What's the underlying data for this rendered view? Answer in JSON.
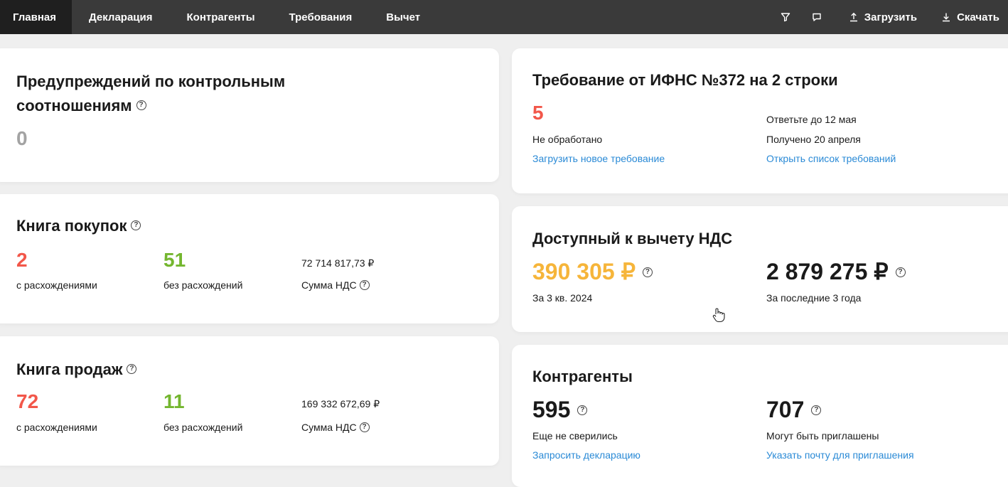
{
  "nav": {
    "tabs": [
      "Главная",
      "Декларация",
      "Контрагенты",
      "Требования",
      "Вычет"
    ],
    "upload": "Загрузить",
    "download": "Скачать",
    "icons": [
      "filter-icon",
      "comment-icon",
      "upload-icon",
      "download-icon"
    ]
  },
  "warnings": {
    "title_line1": "Предупреждений по контрольным",
    "title_line2": "соотношениям",
    "count": "0"
  },
  "purchases": {
    "title": "Книга покупок",
    "mismatch_count": "2",
    "mismatch_label": "с расхождениями",
    "match_count": "51",
    "match_label": "без расхождений",
    "vat_sum": "72 714 817,73 ₽",
    "vat_label": "Сумма НДС"
  },
  "sales": {
    "title": "Книга продаж",
    "mismatch_count": "72",
    "mismatch_label": "с расхождениями",
    "match_count": "11",
    "match_label": "без расхождений",
    "vat_sum": "169 332 672,69 ₽",
    "vat_label": "Сумма НДС"
  },
  "requirement": {
    "title": "Требование от ИФНС №372 на 2 строки",
    "count": "5",
    "count_label": "Не обработано",
    "upload_link": "Загрузить новое требование",
    "deadline": "Ответьте до 12 мая",
    "received": "Получено 20 апреля",
    "list_link": "Открыть список требований"
  },
  "deduction": {
    "title": "Доступный к вычету НДС",
    "quarter_value": "390 305 ₽",
    "quarter_label": "За 3 кв. 2024",
    "years_value": "2 879 275 ₽",
    "years_label": "За последние 3 года"
  },
  "counterparties": {
    "title": "Контрагенты",
    "unverified_count": "595",
    "unverified_label": "Еще не сверились",
    "request_link": "Запросить декларацию",
    "invitable_count": "707",
    "invitable_label": "Могут быть приглашены",
    "email_link": "Указать почту для приглашения"
  },
  "colors": {
    "red": "#f2574a",
    "green": "#74b62f",
    "orange": "#f6b53a",
    "link": "#2a8ad6",
    "topbar": "#3a3a3a"
  }
}
